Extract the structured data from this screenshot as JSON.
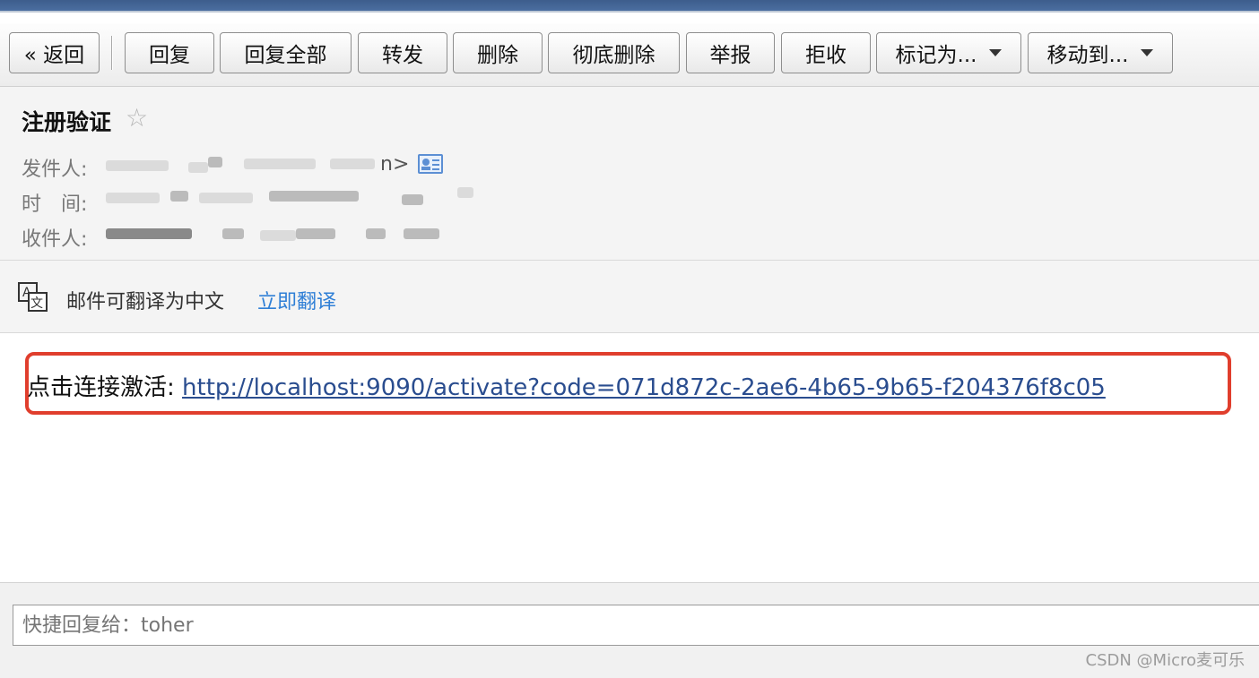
{
  "toolbar": {
    "back": "« 返回",
    "reply": "回复",
    "reply_all": "回复全部",
    "forward": "转发",
    "delete": "删除",
    "delete_perm": "彻底删除",
    "report": "举报",
    "reject": "拒收",
    "mark_as": "标记为...",
    "move_to": "移动到..."
  },
  "mail": {
    "subject": "注册验证",
    "sender_label": "发件人:",
    "sender_visible_tail": "n>",
    "time_label": "时　间:",
    "recipient_label": "收件人:"
  },
  "translate": {
    "text": "邮件可翻译为中文",
    "link": "立即翻译"
  },
  "body": {
    "prefix": "点击连接激活: ",
    "link": "http://localhost:9090/activate?code=071d872c-2ae6-4b65-9b65-f204376f8c05"
  },
  "reply": {
    "placeholder": "快捷回复给：toher"
  },
  "watermark": "CSDN @Micro麦可乐",
  "colors": {
    "accent_link": "#2f7fd6",
    "highlight_border": "#e03e2d",
    "top_bar": "#3d5d8c"
  },
  "icons": [
    "star-icon",
    "contact-card-icon",
    "translate-icon",
    "caret-down-icon"
  ]
}
